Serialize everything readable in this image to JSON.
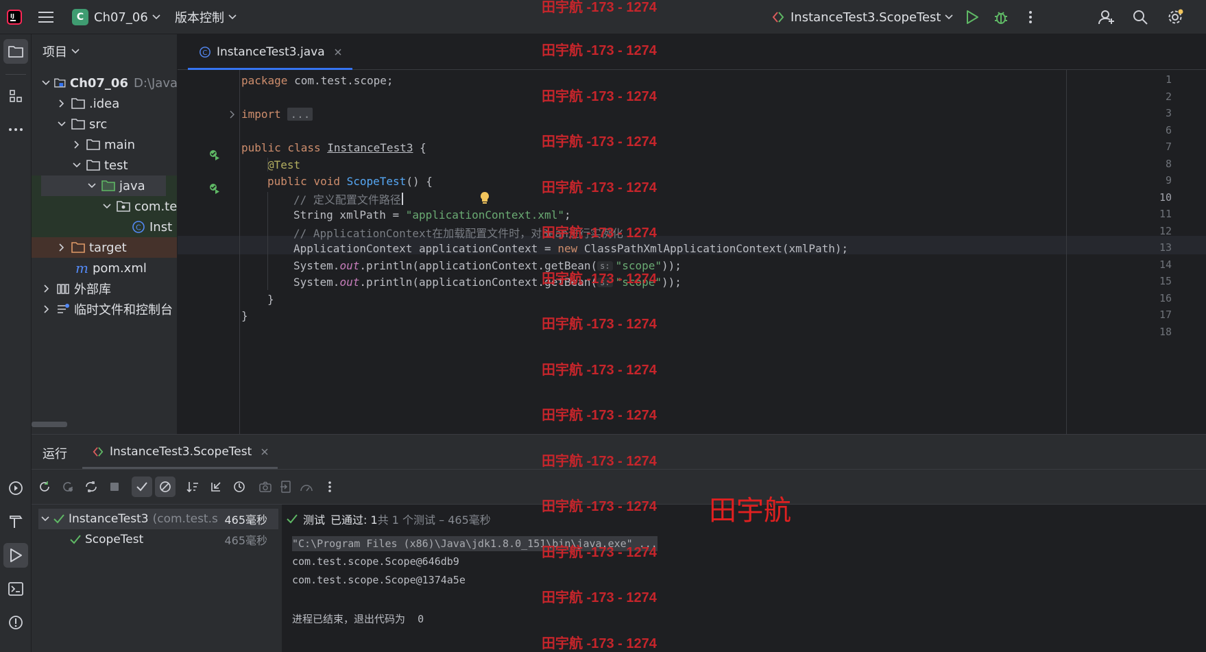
{
  "titlebar": {
    "project_initial": "C",
    "project_name": "Ch07_06",
    "vcs_label": "版本控制",
    "run_config": "InstanceTest3.ScopeTest"
  },
  "project_panel": {
    "title": "项目",
    "tree": [
      {
        "label": "Ch07_06",
        "suffix": "D:\\Java"
      },
      {
        "label": ".idea"
      },
      {
        "label": "src"
      },
      {
        "label": "main"
      },
      {
        "label": "test"
      },
      {
        "label": "java"
      },
      {
        "label": "com.te"
      },
      {
        "label": "Inst"
      },
      {
        "label": "target"
      },
      {
        "label": "pom.xml"
      },
      {
        "label": "外部库"
      },
      {
        "label": "临时文件和控制台"
      }
    ]
  },
  "editor": {
    "tab_label": "InstanceTest3.java",
    "line_numbers": [
      "1",
      "2",
      "3",
      "6",
      "7",
      "8",
      "9",
      "10",
      "11",
      "12",
      "13",
      "14",
      "15",
      "16",
      "17",
      "18"
    ],
    "code": {
      "l1_kw": "package",
      "l1_rest": " com.test.scope;",
      "l3_kw": "import",
      "l3_fold": "...",
      "l7_kw": "public class",
      "l7_name": "InstanceTest3",
      "l7_rest": " {",
      "l8_ann": "@Test",
      "l9_kw": "public void",
      "l9_fn": "ScopeTest",
      "l9_rest": "() {",
      "l10_cmt": "// 定义配置文件路径",
      "l11_a": "String xmlPath = ",
      "l11_str": "\"applicationContext.xml\"",
      "l11_b": ";",
      "l12_cmt": "// ApplicationContext在加载配置文件时，对Bean进行实例化",
      "l13_a": "ApplicationContext applicationContext = ",
      "l13_kw": "new",
      "l13_b": " ClassPathXmlApplicationContext(xmlPath);",
      "l14_a": "System.",
      "l14_it": "out",
      "l14_b": ".println(applicationContext.getBean(",
      "l14_hint": "s:",
      "l14_str": "\"scope\"",
      "l14_c": "));",
      "l15_a": "System.",
      "l15_it": "out",
      "l15_b": ".println(applicationContext.getBean(",
      "l15_hint": "s:",
      "l15_str": "\"scope\"",
      "l15_c": "));",
      "l16": "}",
      "l17": "}"
    }
  },
  "run_panel": {
    "title": "运行",
    "tab_label": "InstanceTest3.ScopeTest",
    "tests": [
      {
        "label": "InstanceTest3",
        "pkg": "(com.test.s",
        "time": "465毫秒"
      },
      {
        "label": "ScopeTest",
        "time": "465毫秒"
      }
    ],
    "status_prefix": "测试",
    "status_passed": "已通过: 1",
    "status_rest": "共 1 个测试 – 465毫秒",
    "console": [
      "\"C:\\Program Files (x86)\\Java\\jdk1.8.0_151\\bin\\java.exe\" ...",
      "com.test.scope.Scope@646db9",
      "com.test.scope.Scope@1374a5e",
      "进程已结束，退出代码为  0"
    ]
  },
  "watermark": {
    "small": "田宇航 -173 - 1274",
    "big": "田宇航"
  },
  "colors": {
    "accent": "#3574f0",
    "success": "#5fb865",
    "watermark": "#c6252b"
  }
}
